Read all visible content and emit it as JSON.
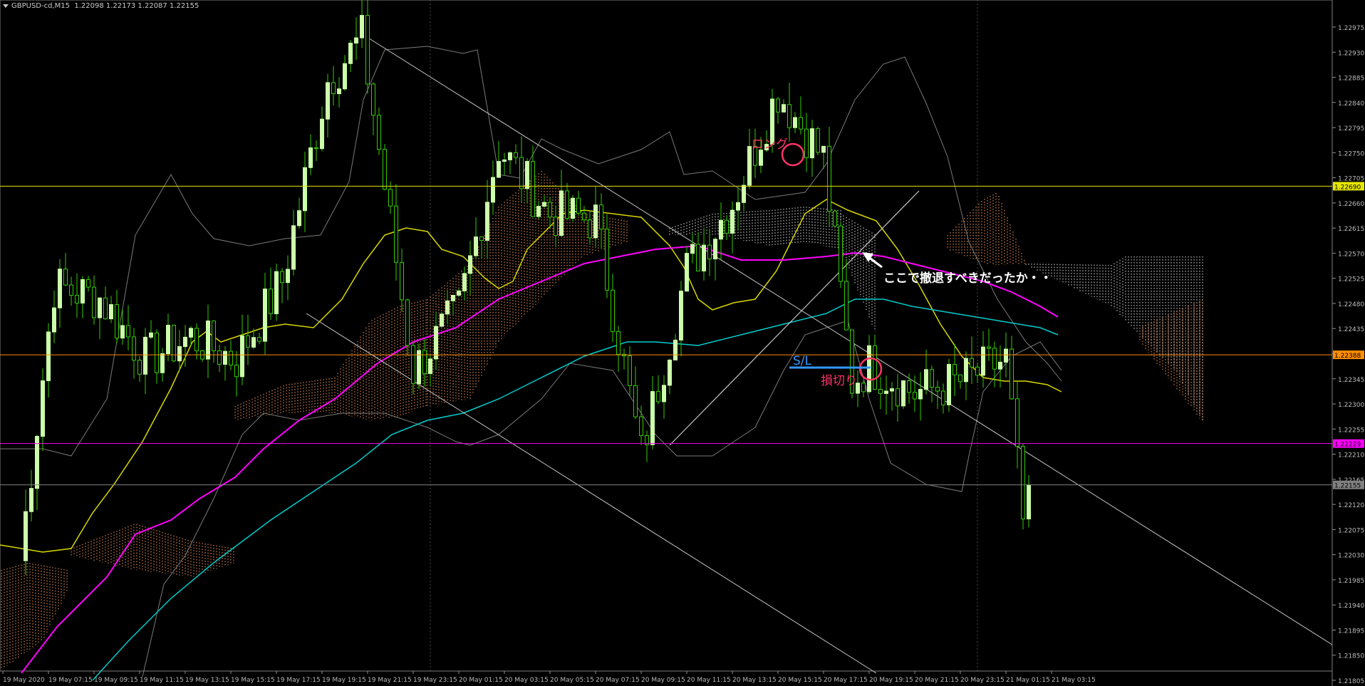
{
  "header": {
    "symbol": "GBPUSD-cd,M15",
    "ohlc": "1.22098 1.22173 1.22087 1.22155"
  },
  "price_axis": {
    "labels": [
      "1.22975",
      "1.22930",
      "1.22885",
      "1.22840",
      "1.22795",
      "1.22750",
      "1.22705",
      "1.22660",
      "1.22615",
      "1.22570",
      "1.22525",
      "1.22480",
      "1.22435",
      "1.22390",
      "1.22345",
      "1.22300",
      "1.22255",
      "1.22210",
      "1.22165",
      "1.22120",
      "1.22075",
      "1.22030",
      "1.21985",
      "1.21940",
      "1.21895",
      "1.21850",
      "1.21805"
    ]
  },
  "time_axis": {
    "labels": [
      "19 May 2020",
      "19 May 07:15",
      "19 May 09:15",
      "19 May 11:15",
      "19 May 13:15",
      "19 May 15:15",
      "19 May 17:15",
      "19 May 19:15",
      "19 May 21:15",
      "19 May 23:15",
      "20 May 01:15",
      "20 May 03:15",
      "20 May 05:15",
      "20 May 07:15",
      "20 May 09:15",
      "20 May 11:15",
      "20 May 13:15",
      "20 May 15:15",
      "20 May 17:15",
      "20 May 19:15",
      "20 May 21:15",
      "20 May 23:15",
      "21 May 01:15",
      "21 May 03:15"
    ]
  },
  "hlines": [
    {
      "price": 1.2269,
      "label": "1.22690",
      "color": "#e6e600",
      "text_color": "#000000"
    },
    {
      "price": 1.22388,
      "label": "1.22388",
      "color": "#ff8c00",
      "text_color": "#000000"
    },
    {
      "price": 1.22229,
      "label": "1.22229",
      "color": "#ff00ff",
      "text_color": "#000000"
    },
    {
      "price": 1.22155,
      "label": "1.22155",
      "color": "#808080",
      "text_color": "#000000"
    }
  ],
  "annotations": {
    "long_label": "ロング",
    "stoploss_label": "S/L",
    "cut_label": "損切り",
    "comment": "ここで撤退すべきだったか・・"
  },
  "colors": {
    "background": "#000000",
    "bull": "#ccffaa",
    "bear": "#33cc00",
    "ma_yellow": "#d7d700",
    "ma_magenta": "#ff00ff",
    "ma_cyan": "#00cccc",
    "bollinger": "#7a7a7a",
    "trendline": "#c8c8c8",
    "cloud": "#ffa060",
    "kumo_white": "#e8e8e8",
    "circle": "#ff3366",
    "sl_blue": "#3399ff",
    "annotation_pink": "#ff3366",
    "grid": "#4a4a4a"
  },
  "chart_data": {
    "type": "candlestick",
    "symbol": "GBPUSD-cd",
    "timeframe": "M15",
    "ylim": [
      1.21805,
      1.22975
    ],
    "last_price": 1.22155,
    "ohlc_points": [
      {
        "t": "19 May 06:00",
        "close": 1.2202
      },
      {
        "t": "19 May 07:30",
        "close": 1.2251
      },
      {
        "t": "19 May 09:30",
        "close": 1.2249
      },
      {
        "t": "19 May 11:30",
        "close": 1.2238
      },
      {
        "t": "19 May 13:30",
        "close": 1.2242
      },
      {
        "t": "19 May 15:30",
        "close": 1.2238
      },
      {
        "t": "19 May 17:30",
        "close": 1.2252
      },
      {
        "t": "19 May 19:30",
        "close": 1.2288
      },
      {
        "t": "19 May 21:00",
        "close": 1.22955
      },
      {
        "t": "19 May 22:00",
        "close": 1.2269
      },
      {
        "t": "19 May 23:15",
        "close": 1.2236
      },
      {
        "t": "20 May 01:15",
        "close": 1.2247
      },
      {
        "t": "20 May 03:00",
        "close": 1.2276
      },
      {
        "t": "20 May 05:15",
        "close": 1.2264
      },
      {
        "t": "20 May 07:15",
        "close": 1.2263
      },
      {
        "t": "20 May 09:15",
        "close": 1.2221
      },
      {
        "t": "20 May 11:15",
        "close": 1.2254
      },
      {
        "t": "20 May 13:15",
        "close": 1.2266
      },
      {
        "t": "20 May 15:15",
        "close": 1.2286
      },
      {
        "t": "20 May 17:15",
        "close": 1.2274
      },
      {
        "t": "20 May 18:30",
        "close": 1.2234
      },
      {
        "t": "20 May 19:15",
        "close": 1.2237
      },
      {
        "t": "20 May 21:15",
        "close": 1.2232
      },
      {
        "t": "20 May 23:15",
        "close": 1.2234
      },
      {
        "t": "21 May 01:15",
        "close": 1.2238
      },
      {
        "t": "21 May 02:00",
        "close": 1.2209
      },
      {
        "t": "21 May 02:15",
        "close": 1.22155
      }
    ]
  }
}
